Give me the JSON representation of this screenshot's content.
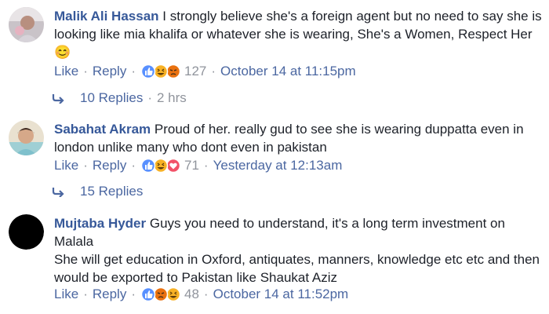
{
  "comments": [
    {
      "author": "Malik Ali Hassan",
      "text": "I strongly believe she's a foreign agent but no need to say she is looking like mia khalifa or whatever she is wearing, She's a Women, Respect Her",
      "emoji": "😊",
      "like_label": "Like",
      "reply_label": "Reply",
      "reactions": [
        "like",
        "haha",
        "angry"
      ],
      "reaction_count": "127",
      "timestamp": "October 14 at 11:15pm",
      "replies_label": "10 Replies",
      "replies_time": "2 hrs"
    },
    {
      "author": "Sabahat Akram",
      "text": "Proud of her. really gud to see she is wearing duppatta even in london unlike many who dont even in pakistan",
      "like_label": "Like",
      "reply_label": "Reply",
      "reactions": [
        "like",
        "haha",
        "love"
      ],
      "reaction_count": "71",
      "timestamp": "Yesterday at 12:13am",
      "replies_label": "15 Replies"
    },
    {
      "author": "Mujtaba Hyder",
      "text": "Guys you need to understand, it's a long term investment on Malala",
      "text_line2": "She will get education in Oxford, antiquates, manners, knowledge etc etc and then would be exported to Pakistan like Shaukat Aziz",
      "like_label": "Like",
      "reply_label": "Reply",
      "reactions": [
        "like",
        "angry",
        "haha"
      ],
      "reaction_count": "48",
      "timestamp": "October 14 at 11:52pm"
    }
  ],
  "colors": {
    "author": "#365899",
    "link": "#4b67a1",
    "meta": "#90949c",
    "text": "#1d2129",
    "like_reaction": "#5890ff",
    "haha_reaction": "#f7b125",
    "angry_reaction": "#e9710f",
    "love_reaction": "#f25268"
  }
}
